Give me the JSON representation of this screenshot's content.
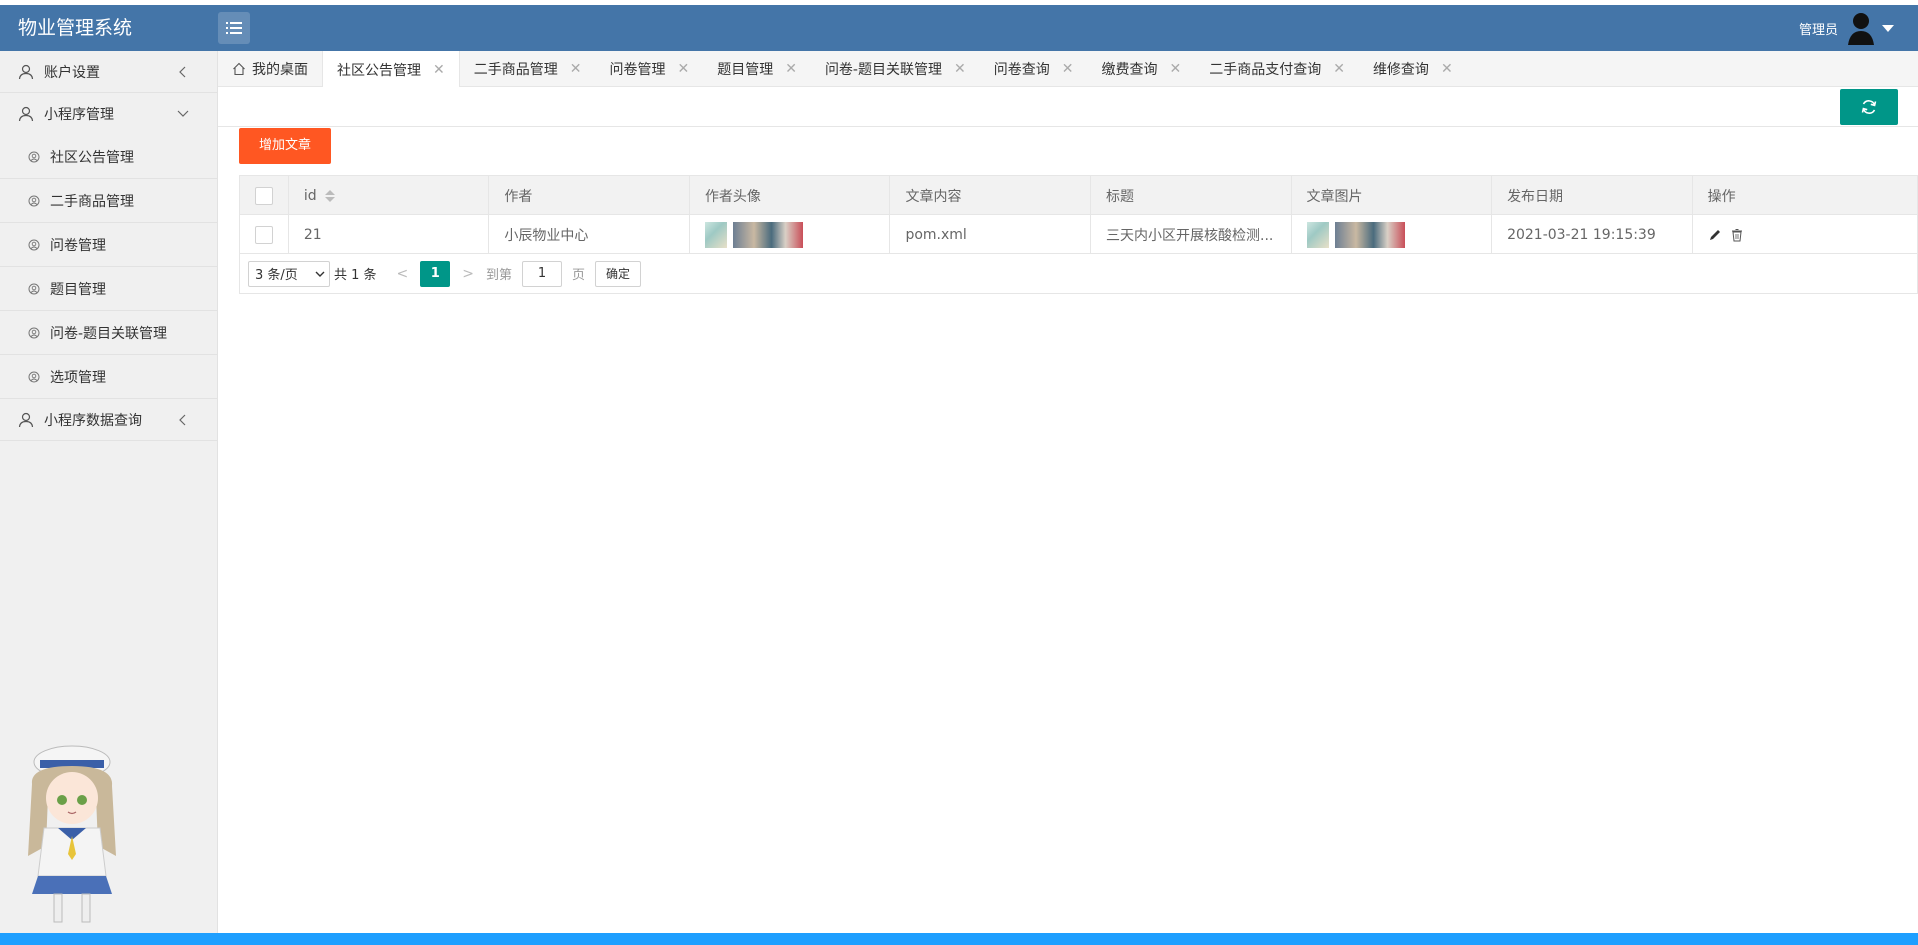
{
  "header": {
    "app_title": "物业管理系统",
    "user_label": "管理员"
  },
  "sidebar": {
    "groups": [
      {
        "label": "账户设置"
      },
      {
        "label": "小程序管理"
      },
      {
        "label": "小程序数据查询"
      }
    ],
    "sub_items": [
      {
        "label": "社区公告管理"
      },
      {
        "label": "二手商品管理"
      },
      {
        "label": "问卷管理"
      },
      {
        "label": "题目管理"
      },
      {
        "label": "问卷-题目关联管理"
      },
      {
        "label": "选项管理"
      }
    ]
  },
  "tabs": [
    {
      "label": "我的桌面"
    },
    {
      "label": "社区公告管理"
    },
    {
      "label": "二手商品管理"
    },
    {
      "label": "问卷管理"
    },
    {
      "label": "题目管理"
    },
    {
      "label": "问卷-题目关联管理"
    },
    {
      "label": "问卷查询"
    },
    {
      "label": "缴费查询"
    },
    {
      "label": "二手商品支付查询"
    },
    {
      "label": "维修查询"
    }
  ],
  "toolbar": {
    "add_label": "增加文章"
  },
  "table": {
    "headers": [
      "id",
      "作者",
      "作者头像",
      "文章内容",
      "标题",
      "文章图片",
      "发布日期",
      "操作"
    ],
    "rows": [
      {
        "id": "21",
        "author": "小辰物业中心",
        "content": "pom.xml",
        "title": "三天内小区开展核酸检测...",
        "date": "2021-03-21 19:15:39"
      }
    ]
  },
  "pager": {
    "page_size": "3 条/页",
    "total": "共 1 条",
    "current_page": "1",
    "goto_label": "到第",
    "goto_value": "1",
    "page_suffix": "页",
    "confirm_label": "确定"
  },
  "colors": {
    "header": "#4475a8",
    "accent": "#009688",
    "add_button": "#ff5722",
    "footer": "#1e9fff"
  }
}
